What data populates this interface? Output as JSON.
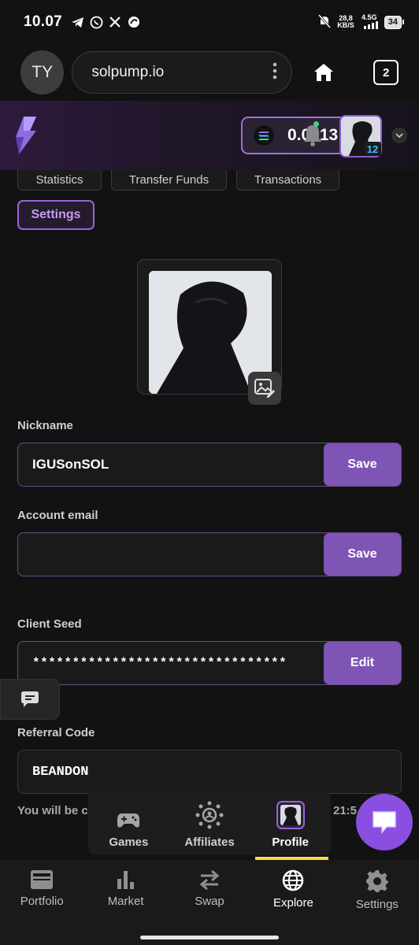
{
  "status_bar": {
    "time": "10.07",
    "net_speed_value": "28,8",
    "net_speed_unit": "KB/S",
    "network": "4.5G",
    "battery": "34"
  },
  "browser": {
    "profile_initials": "TY",
    "url": "solpump.io",
    "tab_count": "2"
  },
  "header": {
    "balance": "0.0013",
    "level": "12"
  },
  "tabs": {
    "statistics": "Statistics",
    "transfer_funds": "Transfer Funds",
    "transactions": "Transactions",
    "settings": "Settings"
  },
  "form": {
    "nickname_label": "Nickname",
    "nickname_value": "IGUSonSOL",
    "nickname_save": "Save",
    "email_label": "Account email",
    "email_value": "",
    "email_save": "Save",
    "seed_label": "Client Seed",
    "seed_value": "********************************",
    "seed_edit": "Edit",
    "referral_label": "Referral Code",
    "referral_value": "BEANDON"
  },
  "note": {
    "text": "You will be c",
    "time": "21:5"
  },
  "site_nav": [
    {
      "label": "Games",
      "icon": "gamepad-icon"
    },
    {
      "label": "Affiliates",
      "icon": "affiliates-icon"
    },
    {
      "label": "Profile",
      "icon": "profile-avatar"
    }
  ],
  "app_nav": [
    {
      "label": "Portfolio",
      "icon": "wallet-icon"
    },
    {
      "label": "Market",
      "icon": "bar-chart-icon"
    },
    {
      "label": "Swap",
      "icon": "swap-icon"
    },
    {
      "label": "Explore",
      "icon": "globe-icon"
    },
    {
      "label": "Settings",
      "icon": "gear-icon"
    }
  ],
  "colors": {
    "accent_purple": "#7e55b5",
    "active_indicator": "#f5dc3c",
    "fab": "#8a4fe0"
  }
}
